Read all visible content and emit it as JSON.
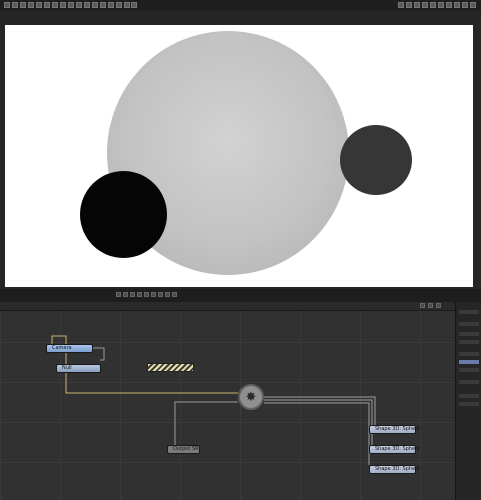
{
  "app": {
    "accent": "#7d9fd0",
    "canvas_bg": "#ffffff"
  },
  "viewer": {
    "toolbar_icons": [
      "viewer-tool-icon"
    ]
  },
  "flow": {
    "nodes": {
      "camera": "Camera",
      "null": "Null",
      "output": "Output SR",
      "shape1": "Shape 3D: Sphere",
      "shape2": "Shape 3D: Sphere",
      "shape3": "Shape 3D: Sphere"
    },
    "merge_icon": "merge-3d-icon"
  }
}
